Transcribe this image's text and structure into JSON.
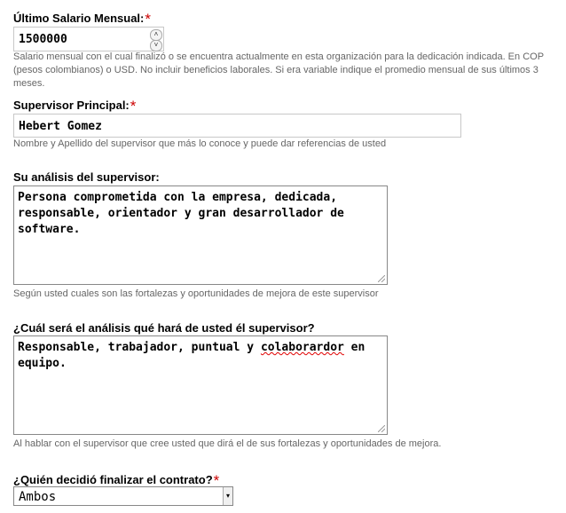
{
  "salary": {
    "label": "Último Salario Mensual:",
    "required_mark": "*",
    "value": "1500000",
    "description": "Salario mensual con el cual finalizó o se encuentra actualmente en esta organización para la dedicación indicada. En COP (pesos colombianos) o USD. No incluir beneficios laborales. Si era variable indique el promedio mensual de sus últimos 3 meses."
  },
  "supervisor": {
    "label": "Supervisor Principal:",
    "required_mark": "*",
    "value": "Hebert Gomez",
    "description": "Nombre y Apellido del supervisor que más lo conoce y puede dar referencias de usted"
  },
  "supervisor_analysis": {
    "label": "Su análisis del supervisor:",
    "value": "Persona comprometida con la empresa, dedicada, responsable, orientador y gran desarrollador de software.",
    "description": "Según usted cuales son las fortalezas y oportunidades de mejora de este supervisor"
  },
  "supervisor_opinion": {
    "label": "¿Cuál será el análisis qué hará de usted él supervisor?",
    "value_before": "Responsable, trabajador, puntual y ",
    "value_misspelled": "colaborardor",
    "value_after": " en equipo.",
    "description": "Al hablar con el supervisor que cree usted que dirá el de sus fortalezas y oportunidades de mejora."
  },
  "contract_end": {
    "label": "¿Quién decidió finalizar el contrato?",
    "required_mark": "*",
    "selected": "Ambos"
  }
}
